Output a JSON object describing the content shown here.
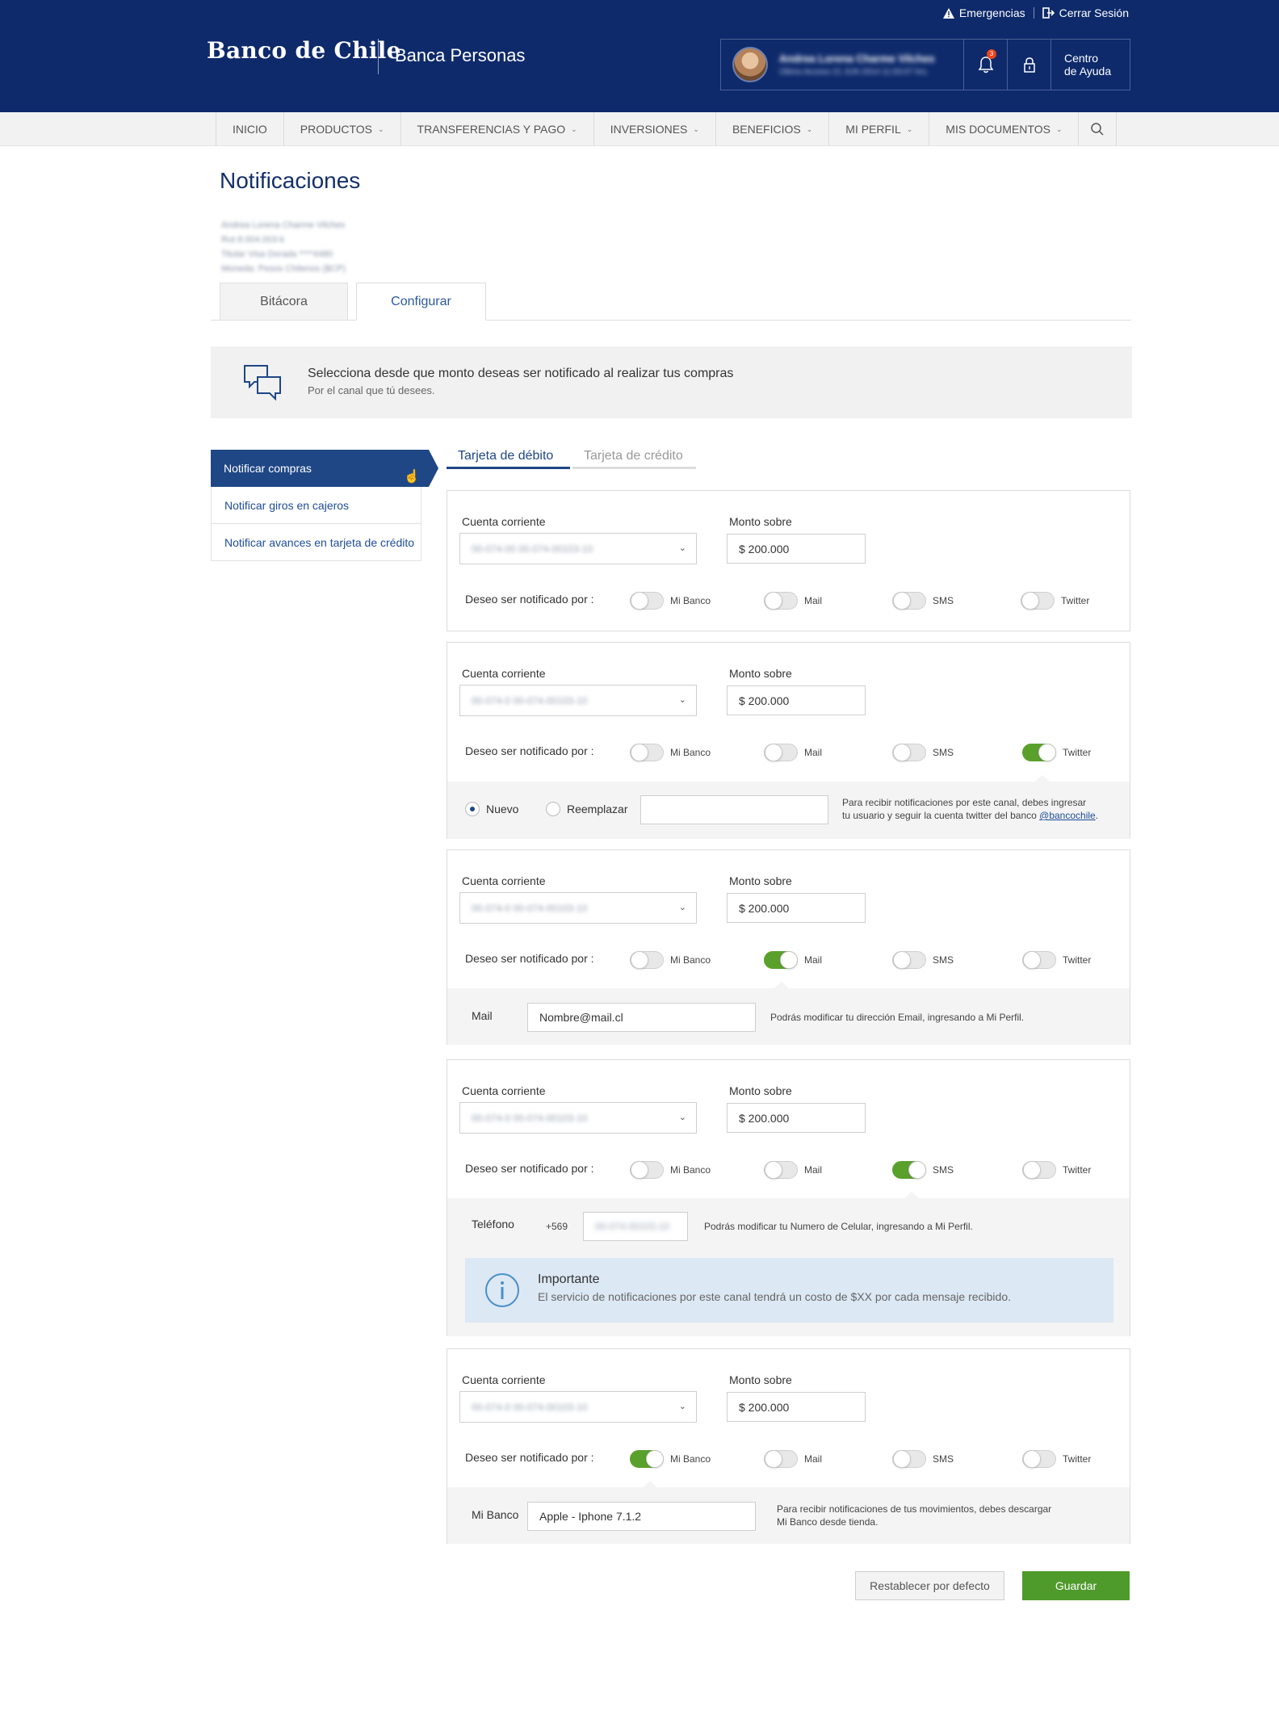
{
  "header": {
    "emergencias": "Emergencias",
    "cerrar_sesion": "Cerrar Sesión",
    "logo": "Banco de Chile",
    "logo_sub": "Banca Personas",
    "user_name": "Andrea Lorena Charme Vilches",
    "user_detail": "Último Acceso 21 JUN 2014 11:03:07 hrs.",
    "notification_count": "3",
    "help_line1": "Centro",
    "help_line2": "de Ayuda"
  },
  "nav": {
    "items": [
      "INICIO",
      "PRODUCTOS",
      "TRANSFERENCIAS Y PAGO",
      "INVERSIONES",
      "BENEFICIOS",
      "MI PERFIL",
      "MIS DOCUMENTOS"
    ]
  },
  "page": {
    "title": "Notificaciones",
    "client_lines": [
      "Andrea Lorena Charme Vilches",
      "Rut 8.004.003-k",
      "Titular Visa Dorada ****4480",
      "Moneda: Pesos Chilenos ($CP)"
    ]
  },
  "tabs": {
    "bitacora": "Bitácora",
    "configurar": "Configurar"
  },
  "banner": {
    "title": "Selecciona desde que monto deseas ser notificado al realizar tus compras",
    "subtitle": "Por el canal que tú desees."
  },
  "side_menu": [
    "Notificar compras",
    "Notificar giros en cajeros",
    "Notificar avances en tarjeta de crédito"
  ],
  "card_tabs": {
    "debito": "Tarjeta de débito",
    "credito": "Tarjeta de crédito"
  },
  "labels": {
    "cuenta": "Cuenta corriente",
    "monto": "Monto sobre",
    "notificado": "Deseo ser notificado por :",
    "channels": [
      "Mi Banco",
      "Mail",
      "SMS",
      "Twitter"
    ]
  },
  "cards": [
    {
      "account": "00-074-00 00-074-00103-10",
      "amount": "$ 200.000",
      "on": ""
    },
    {
      "account": "00-074-0 00-074-00103-10",
      "amount": "$ 200.000",
      "on": "Twitter"
    },
    {
      "account": "00-074-0 00-074-00103-10",
      "amount": "$ 200.000",
      "on": "Mail"
    },
    {
      "account": "00-074-0 00-074-00103-10",
      "amount": "$ 200.000",
      "on": "SMS"
    },
    {
      "account": "00-074-0 00-074-00103-10",
      "amount": "$ 200.000",
      "on": "Mi Banco"
    }
  ],
  "twitter_panel": {
    "radio_new": "Nuevo",
    "radio_replace": "Reemplazar",
    "note_1": "Para recibir notificaciones por este canal, debes ingresar",
    "note_2": "tu usuario y seguir la cuenta twitter del banco ",
    "handle": "@bancochile",
    "note_end": "."
  },
  "mail_panel": {
    "label": "Mail",
    "value": "Nombre@mail.cl",
    "note": "Podrás modificar tu dirección Email, ingresando a Mi Perfil."
  },
  "sms_panel": {
    "label": "Teléfono",
    "prefix": "+569",
    "phone": "00-074-00103-10",
    "note": "Podrás modificar tu Numero de Celular, ingresando a Mi Perfil.",
    "important_title": "Importante",
    "important_text": "El servicio de notificaciones por este canal tendrá un costo de $XX por cada mensaje recibido."
  },
  "mibanco_panel": {
    "label": "Mi Banco",
    "value": "Apple - Iphone 7.1.2",
    "note_1": "Para recibir notificaciones de tus movimientos, debes descargar",
    "note_2": "Mi Banco desde tienda."
  },
  "buttons": {
    "reset": "Restablecer por defecto",
    "save": "Guardar"
  },
  "colors": {
    "header": "#0e2a6b",
    "accent": "#1f4786",
    "toggle_on": "#5aa12c",
    "save": "#4e9a2b"
  }
}
